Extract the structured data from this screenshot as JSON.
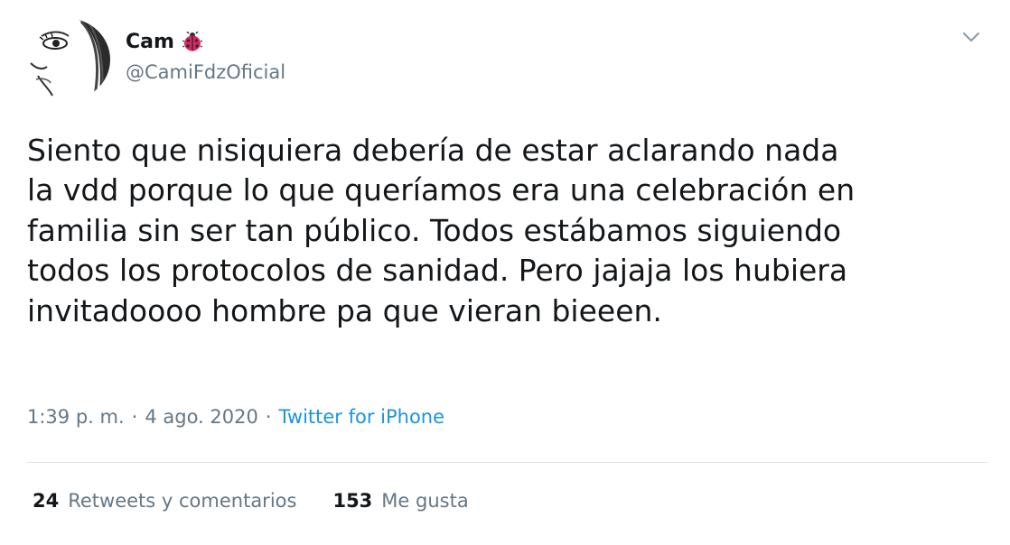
{
  "user": {
    "display_name": "Cam",
    "handle": "@CamiFdzOficial",
    "badge_icon": "ladybug-icon",
    "avatar_icon": "sketch-face-avatar"
  },
  "tweet": {
    "lines": [
      "Siento que nisiquiera debería de estar aclarando nada",
      "la vdd porque lo que queríamos era una celebración en",
      "familia sin ser tan público. Todos estábamos siguiendo",
      "todos los protocolos de sanidad. Pero jajaja los hubiera",
      "invitadoooo hombre pa que vieran bieeen."
    ]
  },
  "meta": {
    "time": "1:39 p. m.",
    "sep1": "·",
    "date": "4 ago. 2020",
    "sep2": "·",
    "source": "Twitter for iPhone"
  },
  "stats": {
    "retweets_count": "24",
    "retweets_label": "Retweets y comentarios",
    "likes_count": "153",
    "likes_label": "Me gusta"
  },
  "colors": {
    "text": "#14171a",
    "secondary": "#657786",
    "link": "#1b95e0",
    "divider": "#e1e8ed",
    "ladybug_red": "#e0245e"
  }
}
